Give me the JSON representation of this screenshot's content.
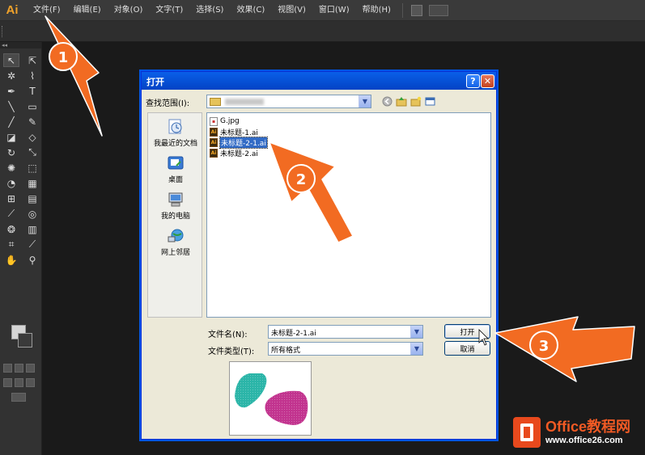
{
  "app": {
    "logo": "Ai",
    "menu": [
      "文件(F)",
      "编辑(E)",
      "对象(O)",
      "文字(T)",
      "选择(S)",
      "效果(C)",
      "视图(V)",
      "窗口(W)",
      "帮助(H)"
    ]
  },
  "dialog": {
    "title": "打开",
    "look_in_label": "查找范围(I):",
    "places": [
      "我最近的文档",
      "桌面",
      "我的电脑",
      "网上邻居"
    ],
    "files": [
      {
        "name": "G.jpg",
        "type": "jpg"
      },
      {
        "name": "未标题-1.ai",
        "type": "ai"
      },
      {
        "name": "未标题-2-1.ai",
        "type": "ai",
        "selected": true
      },
      {
        "name": "未标题-2.ai",
        "type": "ai"
      }
    ],
    "file_name_label": "文件名(N):",
    "file_name_value": "未标题-2-1.ai",
    "file_type_label": "文件类型(T):",
    "file_type_value": "所有格式",
    "open_button": "打开",
    "cancel_button": "取消"
  },
  "annotations": [
    "1",
    "2",
    "3"
  ],
  "watermark": {
    "title": "Office教程网",
    "url": "www.office26.com"
  },
  "colors": {
    "arrow": "#f26b22",
    "titlebar": "#0054e3",
    "selection": "#316ac5",
    "preview_teal": "#2bb5a8",
    "preview_magenta": "#c2348f"
  }
}
